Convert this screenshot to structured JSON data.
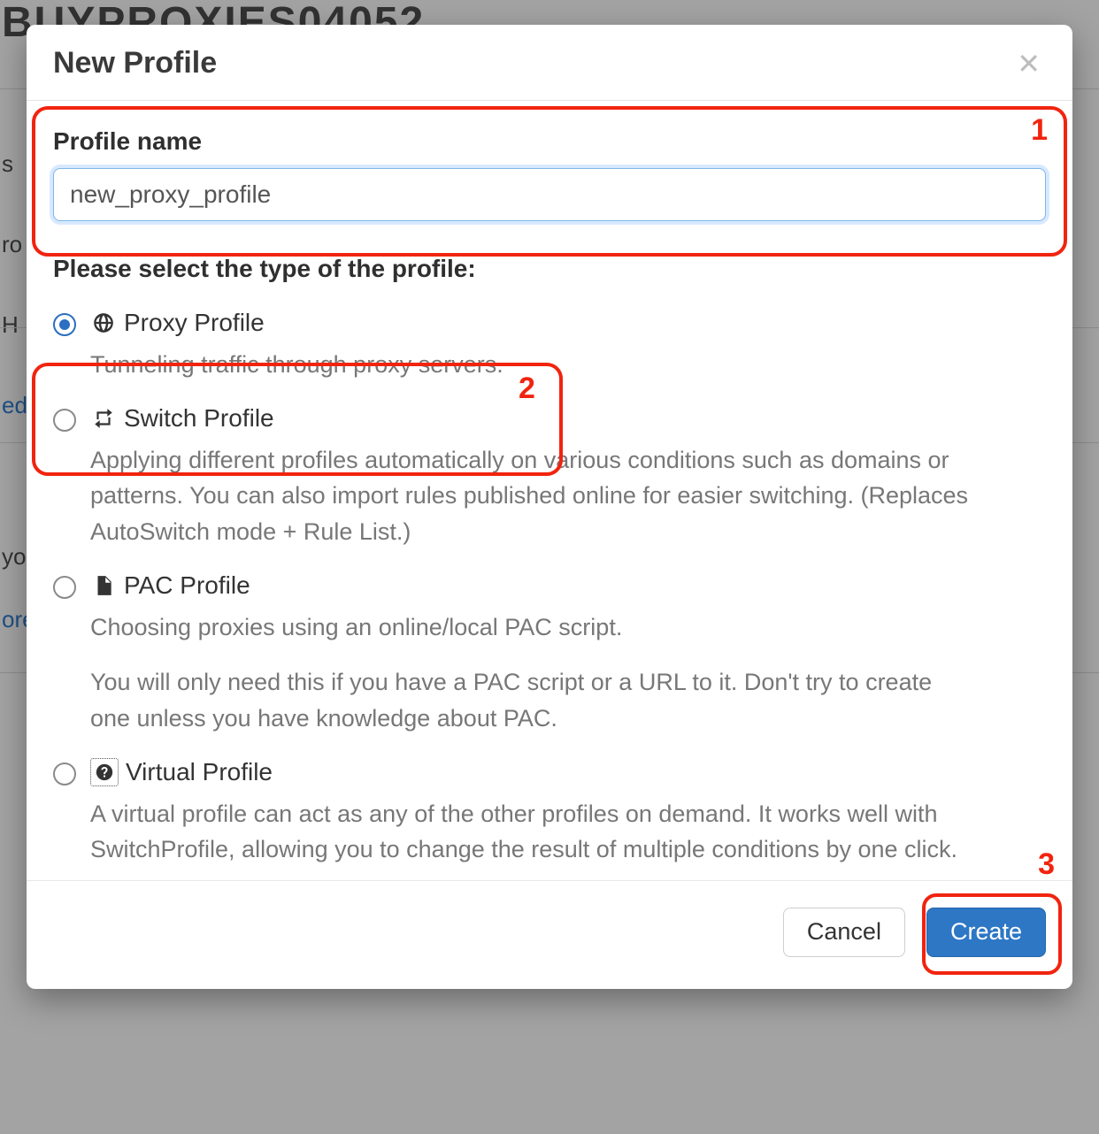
{
  "background": {
    "header_cutoff": "BUYPROXIES04052",
    "left_fragments": [
      "s",
      "ro",
      "H",
      "ed",
      "yo",
      "ore"
    ]
  },
  "modal": {
    "title": "New Profile",
    "close_aria": "Close",
    "profile_name_label": "Profile name",
    "profile_name_value": "new_proxy_profile",
    "select_type_heading": "Please select the type of the profile:",
    "options": [
      {
        "id": "proxy",
        "title": "Proxy Profile",
        "icon": "globe-icon",
        "selected": true,
        "desc": "Tunneling traffic through proxy servers."
      },
      {
        "id": "switch",
        "title": "Switch Profile",
        "icon": "retweet-icon",
        "selected": false,
        "desc": "Applying different profiles automatically on various conditions such as domains or patterns. You can also import rules published online for easier switching. (Replaces AutoSwitch mode + Rule List.)"
      },
      {
        "id": "pac",
        "title": "PAC Profile",
        "icon": "file-icon",
        "selected": false,
        "desc": "Choosing proxies using an online/local PAC script.",
        "desc2": "You will only need this if you have a PAC script or a URL to it. Don't try to create one unless you have knowledge about PAC."
      },
      {
        "id": "virtual",
        "title": "Virtual Profile",
        "icon": "question-circle-icon",
        "selected": false,
        "desc": "A virtual profile can act as any of the other profiles on demand. It works well with SwitchProfile, allowing you to change the result of multiple conditions by one click."
      }
    ],
    "cancel_label": "Cancel",
    "create_label": "Create"
  },
  "annotations": {
    "n1": "1",
    "n2": "2",
    "n3": "3"
  }
}
